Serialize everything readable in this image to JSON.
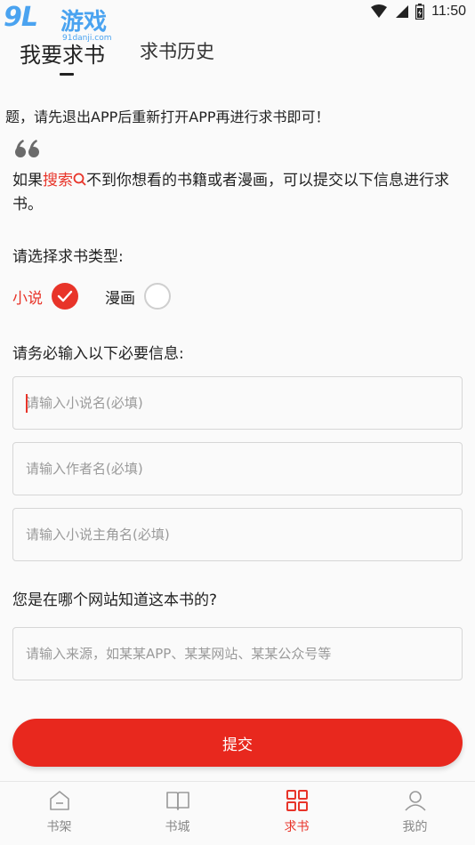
{
  "status_bar": {
    "watermark_logo": "9L",
    "watermark_text": "游戏",
    "watermark_url": "91danji.com",
    "time": "11:50"
  },
  "header": {
    "tabs": [
      {
        "label": "我要求书",
        "active": true
      },
      {
        "label": "求书历史",
        "active": false
      }
    ]
  },
  "notice": "题，请先退出APP后重新打开APP再进行求书即可！",
  "intro": {
    "prefix": "如果",
    "link": "搜索",
    "suffix": "不到你想看的书籍或者漫画，可以提交以下信息进行求书。"
  },
  "form": {
    "type_label": "请选择求书类型:",
    "types": [
      {
        "label": "小说",
        "selected": true
      },
      {
        "label": "漫画",
        "selected": false
      }
    ],
    "info_label": "请务必输入以下必要信息:",
    "fields": {
      "novel_name": {
        "placeholder": "请输入小说名(必填)",
        "value": ""
      },
      "author": {
        "placeholder": "请输入作者名(必填)",
        "value": ""
      },
      "protagonist": {
        "placeholder": "请输入小说主角名(必填)",
        "value": ""
      }
    },
    "source_label": "您是在哪个网站知道这本书的?",
    "source": {
      "placeholder": "请输入来源，如某某APP、某某网站、某某公众号等",
      "value": ""
    },
    "submit_label": "提交"
  },
  "bottom_nav": {
    "items": [
      {
        "label": "书架",
        "icon": "bookshelf-icon",
        "active": false
      },
      {
        "label": "书城",
        "icon": "book-store-icon",
        "active": false
      },
      {
        "label": "求书",
        "icon": "request-grid-icon",
        "active": true
      },
      {
        "label": "我的",
        "icon": "profile-icon",
        "active": false
      }
    ]
  },
  "colors": {
    "accent": "#e83429",
    "submit": "#e8281e",
    "watermark": "#4aa3f0",
    "text": "#222222",
    "muted": "#888888"
  }
}
